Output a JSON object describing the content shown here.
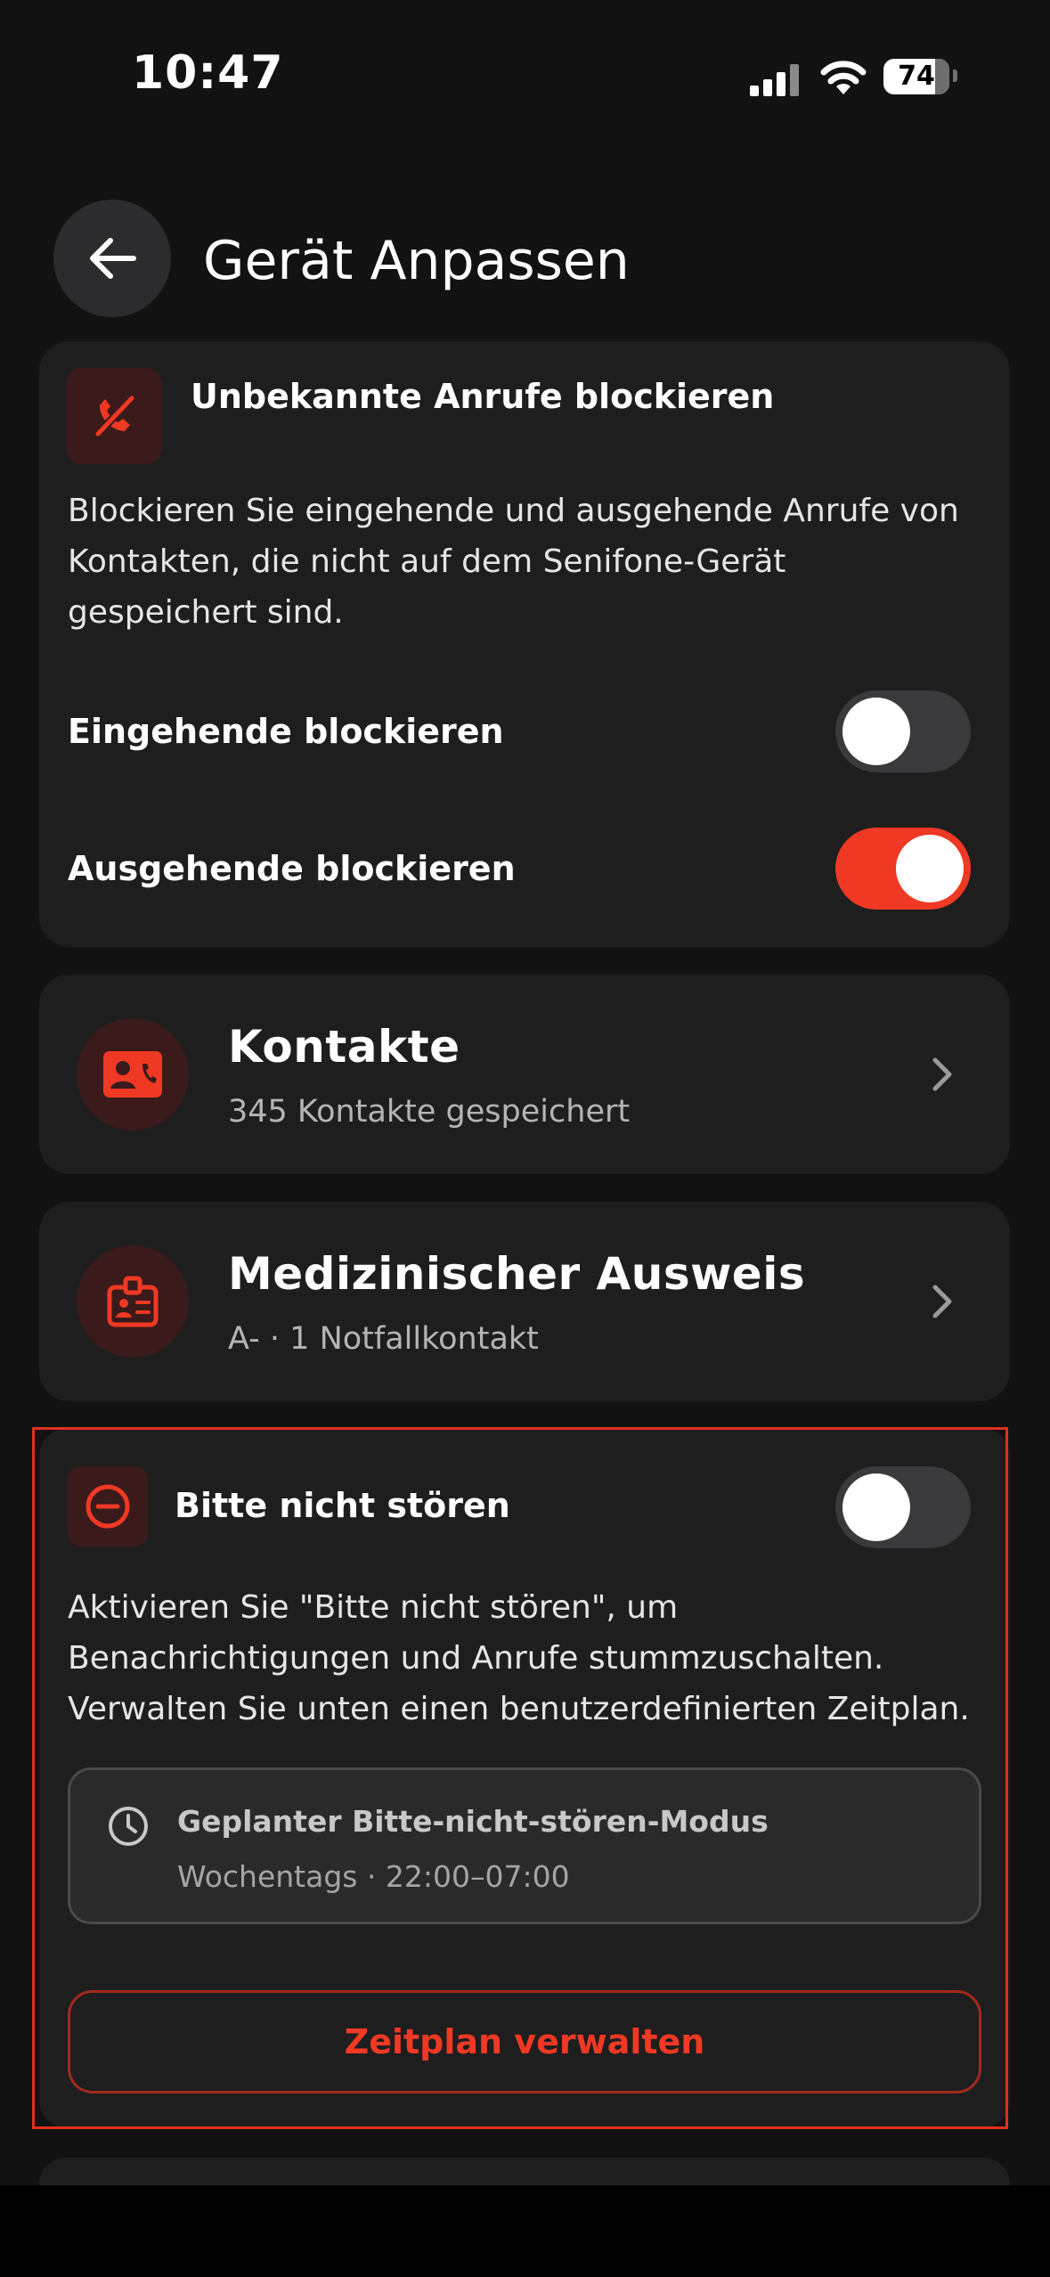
{
  "status_bar": {
    "time": "10:47",
    "battery": "74"
  },
  "header": {
    "title": "Gerät Anpassen"
  },
  "block_calls": {
    "title": "Unbekannte Anrufe blockieren",
    "description_lines": [
      "Blockieren Sie eingehende und ausgehende Anrufe von",
      "Kontakten, die nicht auf dem Senifone-Gerät",
      "gespeichert sind."
    ],
    "incoming_label": "Eingehende blockieren",
    "incoming_on": false,
    "outgoing_label": "Ausgehende blockieren",
    "outgoing_on": true
  },
  "contacts": {
    "title": "Kontakte",
    "subtitle": "345 Kontakte gespeichert"
  },
  "medical_id": {
    "title": "Medizinischer Ausweis",
    "subtitle": "A- · 1 Notfallkontakt"
  },
  "dnd": {
    "title": "Bitte nicht stören",
    "enabled": false,
    "description_lines": [
      "Aktivieren Sie \"Bitte nicht stören\", um",
      "Benachrichtigungen und Anrufe stummzuschalten.",
      "Verwalten Sie unten einen benutzerdefinierten Zeitplan."
    ],
    "schedule_title": "Geplanter Bitte-nicht-stören-Modus",
    "schedule_subtitle": "Wochentags · 22:00–07:00",
    "manage_button": "Zeitplan verwalten"
  },
  "colors": {
    "accent": "#ef3924",
    "card": "#1e1e1e",
    "background": "#121212",
    "icon_bg": "#3a1a1a"
  },
  "icons": [
    "arrow-left-icon",
    "phone-blocked-icon",
    "contact-card-icon",
    "medical-badge-icon",
    "minus-circle-icon",
    "clock-icon",
    "chevron-right-icon",
    "signal-icon",
    "wifi-icon",
    "battery-icon"
  ]
}
